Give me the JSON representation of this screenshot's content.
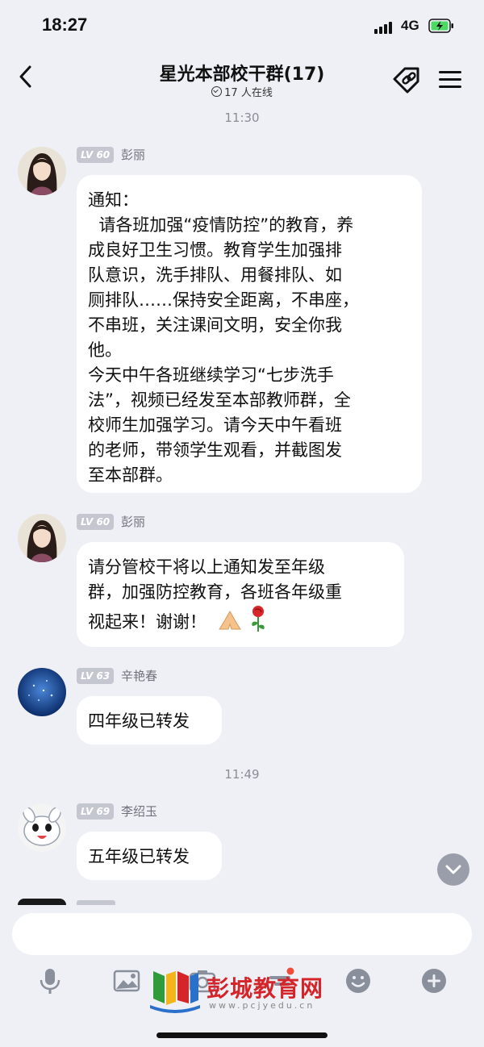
{
  "status": {
    "time": "18:27",
    "network": "4G"
  },
  "header": {
    "title": "星光本部校干群(17)",
    "online": "17 人在线"
  },
  "messages": [
    {
      "sender": "彭丽",
      "level": "LV 60",
      "lines": [
        "通知：",
        "  请各班加强“疫情防控”的教育，养",
        "成良好卫生习惯。教育学生加强排",
        "队意识，洗手排队、用餐排队、如",
        "厕排队……保持安全距离，不串座，",
        "不串班，关注课间文明，安全你我",
        "他。",
        "今天中午各班继续学习“七步洗手",
        "法”，视频已经发至本部教师群，全",
        "校师生加强学习。请今天中午看班",
        "的老师，带领学生观看，并截图发",
        "至本部群。"
      ]
    },
    {
      "sender": "彭丽",
      "level": "LV 60",
      "lines": [
        "请分管校干将以上通知发至年级",
        "群，加强防控教育，各班各年级重",
        "视起来！谢谢！"
      ]
    },
    {
      "sender": "辛艳春",
      "level": "LV 63",
      "lines": [
        "四年级已转发"
      ]
    },
    {
      "sender": "李绍玉",
      "level": "LV 69",
      "lines": [
        "五年级已转发"
      ]
    }
  ],
  "time_separators": [
    "11:30",
    "11:49"
  ],
  "toolbar": {
    "icons": [
      "mic-icon",
      "image-icon",
      "camera-icon",
      "scissors-icon",
      "emoji-icon",
      "plus-icon"
    ]
  },
  "watermark": {
    "text": "彭城教育网",
    "url": "www.pcjyedu.cn"
  },
  "colors": {
    "bubble": "#ffffff",
    "background": "#eef0f5",
    "level_badge": "#c4c7d0",
    "watermark": "#d4252a"
  }
}
